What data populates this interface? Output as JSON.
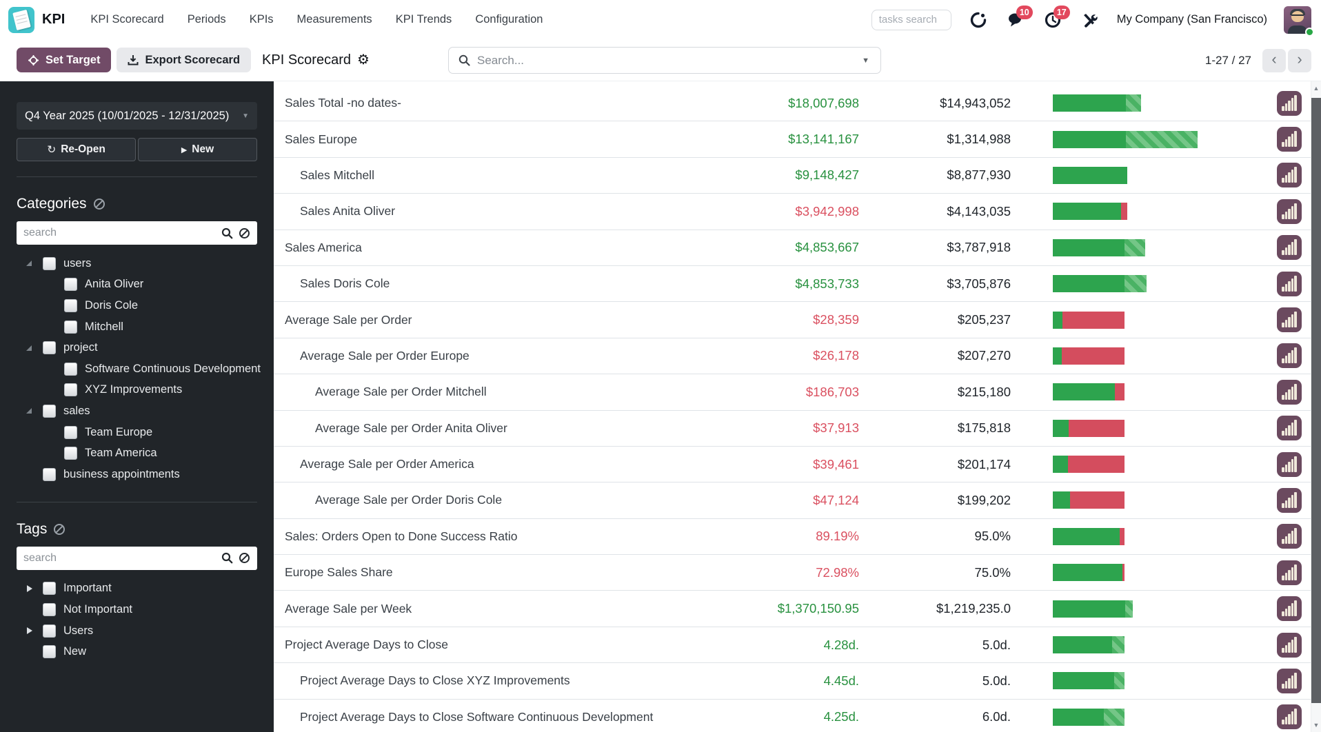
{
  "navbar": {
    "brand": "KPI",
    "menus": [
      "KPI Scorecard",
      "Periods",
      "KPIs",
      "Measurements",
      "KPI Trends",
      "Configuration"
    ],
    "tasks_search_placeholder": "tasks search",
    "badges": {
      "chat": "10",
      "activities": "17"
    },
    "company": "My Company (San Francisco)"
  },
  "toolbar": {
    "set_target_label": "Set Target",
    "export_label": "Export Scorecard",
    "title": "KPI Scorecard",
    "search_placeholder": "Search...",
    "pager": "1-27 / 27",
    "prev_label": "‹",
    "next_label": "›"
  },
  "sidebar": {
    "period": "Q4 Year 2025 (10/01/2025 - 12/31/2025)",
    "reopen_label": "Re-Open",
    "new_label": "New",
    "categories": {
      "title": "Categories",
      "search_placeholder": "search",
      "items": [
        {
          "label": "users",
          "level": 0,
          "caret": "expanded"
        },
        {
          "label": "Anita Oliver",
          "level": 1,
          "caret": "none"
        },
        {
          "label": "Doris Cole",
          "level": 1,
          "caret": "none"
        },
        {
          "label": "Mitchell",
          "level": 1,
          "caret": "none"
        },
        {
          "label": "project",
          "level": 0,
          "caret": "expanded"
        },
        {
          "label": "Software Continuous Development",
          "level": 1,
          "caret": "none"
        },
        {
          "label": "XYZ Improvements",
          "level": 1,
          "caret": "none"
        },
        {
          "label": "sales",
          "level": 0,
          "caret": "expanded"
        },
        {
          "label": "Team Europe",
          "level": 1,
          "caret": "none"
        },
        {
          "label": "Team America",
          "level": 1,
          "caret": "none"
        },
        {
          "label": "business appointments",
          "level": 0,
          "caret": "none"
        }
      ]
    },
    "tags": {
      "title": "Tags",
      "search_placeholder": "search",
      "items": [
        {
          "label": "Important",
          "level": 0,
          "caret": "collapsed"
        },
        {
          "label": "Not Important",
          "level": 0,
          "caret": "none"
        },
        {
          "label": "Users",
          "level": 0,
          "caret": "collapsed"
        },
        {
          "label": "New",
          "level": 0,
          "caret": "none"
        }
      ]
    }
  },
  "table": {
    "rows": [
      {
        "name": "Sales Total -no dates-",
        "indent": 0,
        "value": "$18,007,698",
        "value_color": "green",
        "target": "$14,943,052",
        "bar": {
          "solid": 106,
          "striped": 22,
          "over": 0
        }
      },
      {
        "name": "Sales Europe",
        "indent": 0,
        "value": "$13,141,167",
        "value_color": "green",
        "target": "$1,314,988",
        "bar": {
          "solid": 106,
          "striped": 104,
          "over": 0
        }
      },
      {
        "name": "Sales Mitchell",
        "indent": 1,
        "value": "$9,148,427",
        "value_color": "green",
        "target": "$8,877,930",
        "bar": {
          "solid": 108,
          "striped": 0,
          "over": 0
        }
      },
      {
        "name": "Sales Anita Oliver",
        "indent": 1,
        "value": "$3,942,998",
        "value_color": "red",
        "target": "$4,143,035",
        "bar": {
          "solid": 99,
          "striped": 0,
          "over": 9
        }
      },
      {
        "name": "Sales America",
        "indent": 0,
        "value": "$4,853,667",
        "value_color": "green",
        "target": "$3,787,918",
        "bar": {
          "solid": 104,
          "striped": 30,
          "over": 0
        }
      },
      {
        "name": "Sales Doris Cole",
        "indent": 1,
        "value": "$4,853,733",
        "value_color": "green",
        "target": "$3,705,876",
        "bar": {
          "solid": 104,
          "striped": 32,
          "over": 0
        }
      },
      {
        "name": "Average Sale per Order",
        "indent": 0,
        "value": "$28,359",
        "value_color": "red",
        "target": "$205,237",
        "bar": {
          "solid": 14,
          "striped": 0,
          "over": 90
        }
      },
      {
        "name": "Average Sale per Order Europe",
        "indent": 1,
        "value": "$26,178",
        "value_color": "red",
        "target": "$207,270",
        "bar": {
          "solid": 13,
          "striped": 0,
          "over": 91
        }
      },
      {
        "name": "Average Sale per Order Mitchell",
        "indent": 2,
        "value": "$186,703",
        "value_color": "red",
        "target": "$215,180",
        "bar": {
          "solid": 90,
          "striped": 0,
          "over": 14
        }
      },
      {
        "name": "Average Sale per Order Anita Oliver",
        "indent": 2,
        "value": "$37,913",
        "value_color": "red",
        "target": "$175,818",
        "bar": {
          "solid": 23,
          "striped": 0,
          "over": 81
        }
      },
      {
        "name": "Average Sale per Order America",
        "indent": 1,
        "value": "$39,461",
        "value_color": "red",
        "target": "$201,174",
        "bar": {
          "solid": 22,
          "striped": 0,
          "over": 82
        }
      },
      {
        "name": "Average Sale per Order Doris Cole",
        "indent": 2,
        "value": "$47,124",
        "value_color": "red",
        "target": "$199,202",
        "bar": {
          "solid": 25,
          "striped": 0,
          "over": 79
        }
      },
      {
        "name": "Sales: Orders Open to Done Success Ratio",
        "indent": 0,
        "value": "89.19%",
        "value_color": "red",
        "target": "95.0%",
        "bar": {
          "solid": 97,
          "striped": 0,
          "over": 7
        }
      },
      {
        "name": "Europe Sales Share",
        "indent": 0,
        "value": "72.98%",
        "value_color": "red",
        "target": "75.0%",
        "bar": {
          "solid": 101,
          "striped": 0,
          "over": 3
        }
      },
      {
        "name": "Average Sale per Week",
        "indent": 0,
        "value": "$1,370,150.95",
        "value_color": "green",
        "target": "$1,219,235.0",
        "bar": {
          "solid": 105,
          "striped": 11,
          "over": 0
        }
      },
      {
        "name": "Project Average Days to Close",
        "indent": 0,
        "value": "4.28d.",
        "value_color": "green",
        "target": "5.0d.",
        "bar": {
          "solid": 86,
          "striped": 18,
          "over": 0
        }
      },
      {
        "name": "Project Average Days to Close XYZ Improvements",
        "indent": 1,
        "value": "4.45d.",
        "value_color": "green",
        "target": "5.0d.",
        "bar": {
          "solid": 89,
          "striped": 15,
          "over": 0
        }
      },
      {
        "name": "Project Average Days to Close Software Continuous Development",
        "indent": 1,
        "value": "4.25d.",
        "value_color": "green",
        "target": "6.0d.",
        "bar": {
          "solid": 74,
          "striped": 30,
          "over": 0
        }
      }
    ]
  },
  "colors": {
    "accent": "#714b67",
    "logo_teal": "#41c4cc",
    "badge_red": "#e2485d",
    "value_green": "#28913f",
    "value_red": "#da5060",
    "bar_green": "#2da44e",
    "bar_red": "#d44d5e",
    "sidebar_bg": "#212529",
    "chart_button_bg": "#6b4a5f"
  }
}
